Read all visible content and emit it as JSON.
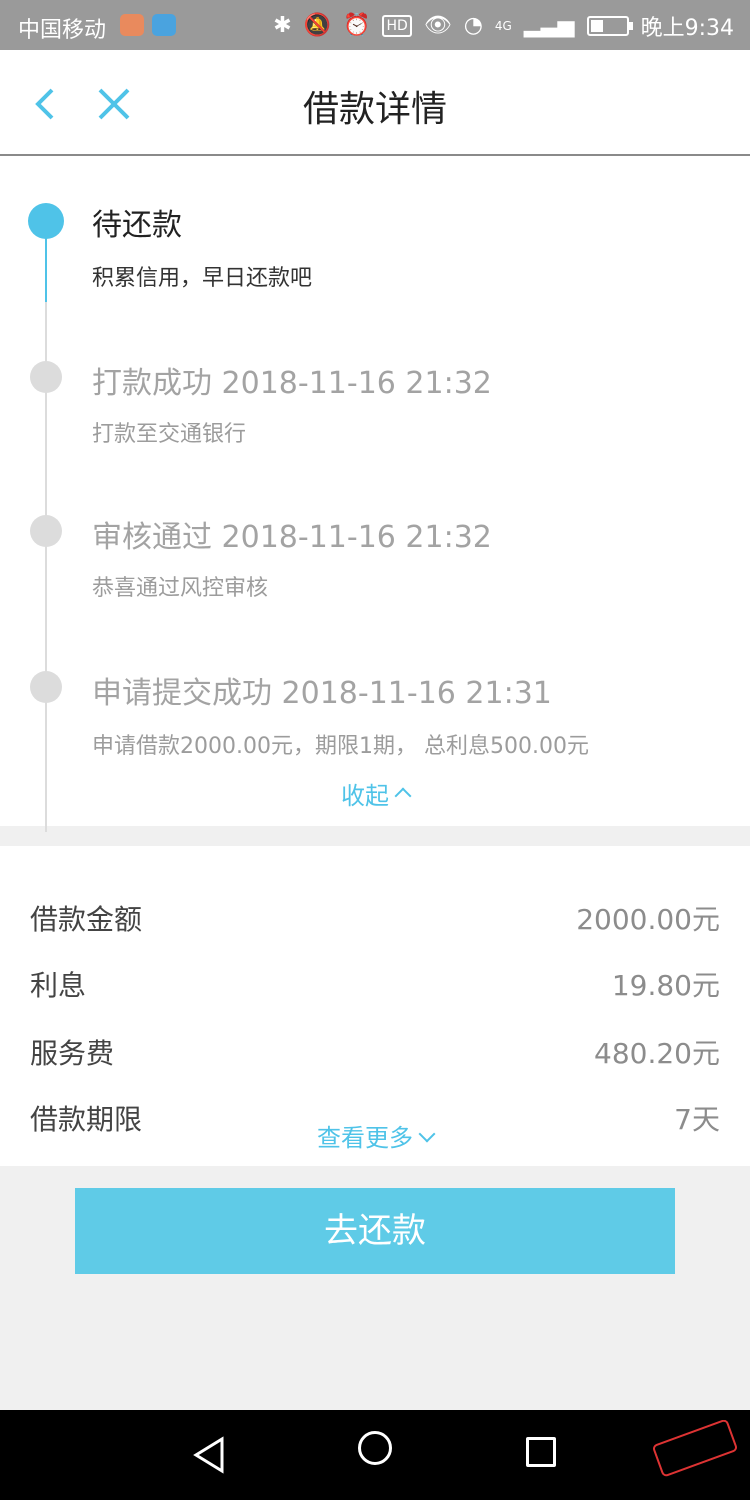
{
  "status_bar": {
    "carrier": "中国移动",
    "network": "4G",
    "time": "晚上9:34",
    "battery_level": 0.35,
    "icons": [
      "bluetooth-icon",
      "mute-icon",
      "alarm-icon",
      "hd-icon",
      "eye-icon",
      "wifi-icon",
      "signal-icon",
      "battery-icon"
    ]
  },
  "header": {
    "title": "借款详情",
    "back_icon": "chevron-left-icon",
    "close_icon": "close-icon"
  },
  "timeline": {
    "events": [
      {
        "title": "待还款",
        "desc": "积累信用，早日还款吧",
        "active": true
      },
      {
        "title": "打款成功 2018-11-16 21:32",
        "desc": "打款至交通银行",
        "active": false
      },
      {
        "title": "审核通过 2018-11-16 21:32",
        "desc": "恭喜通过风控审核",
        "active": false
      },
      {
        "title": "申请提交成功 2018-11-16 21:31",
        "desc": "申请借款2000.00元，期限1期， 总利息500.00元",
        "active": false
      }
    ],
    "collapse_label": "收起"
  },
  "details": {
    "rows": [
      {
        "label": "借款金额",
        "value": "2000.00元"
      },
      {
        "label": "利息",
        "value": "19.80元"
      },
      {
        "label": "服务费",
        "value": "480.20元"
      },
      {
        "label": "借款期限",
        "value": "7天"
      }
    ],
    "more_label": "查看更多"
  },
  "pay_button": {
    "label": "去还款"
  },
  "colors": {
    "accent": "#4fc3e8",
    "button": "#5fcbe7",
    "muted": "#dcdcdc"
  }
}
